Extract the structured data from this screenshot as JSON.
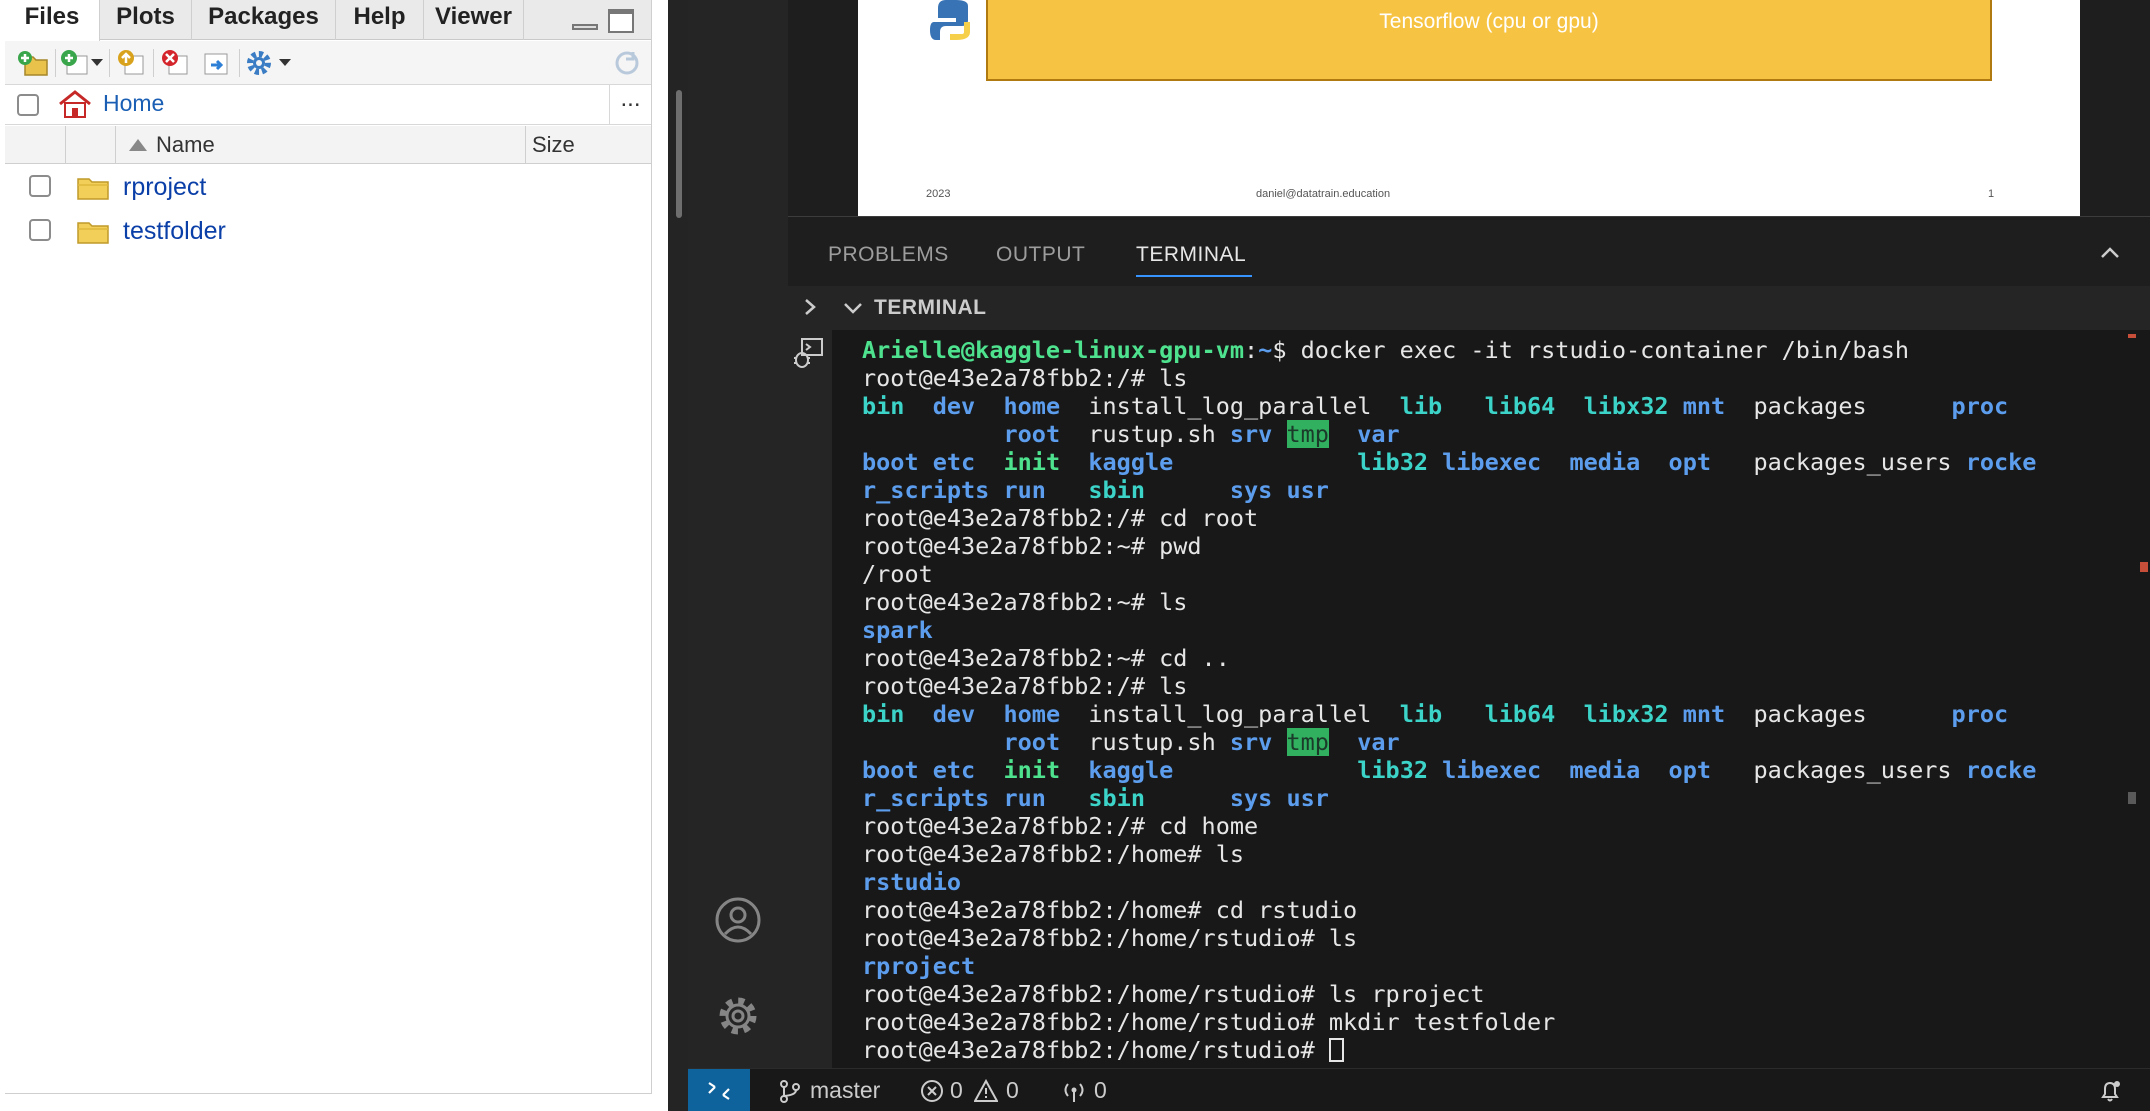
{
  "rstudio": {
    "tabs": [
      "Files",
      "Plots",
      "Packages",
      "Help",
      "Viewer"
    ],
    "active_tab": "Files",
    "path": "Home",
    "more": "...",
    "columns": {
      "name": "Name",
      "size": "Size"
    },
    "files": [
      {
        "name": "rproject",
        "type": "folder"
      },
      {
        "name": "testfolder",
        "type": "folder"
      }
    ],
    "toolbar_icons": [
      "new-folder-icon",
      "new-blank-file-icon",
      "upload-icon",
      "delete-icon",
      "rename-icon",
      "more-gear-icon",
      "refresh-icon"
    ]
  },
  "vscode": {
    "pdf": {
      "box_text": "Tensorflow (cpu or gpu)",
      "footer_left": "2023",
      "footer_center": "daniel@datatrain.education",
      "footer_right": "1"
    },
    "panel_tabs": [
      "PROBLEMS",
      "OUTPUT",
      "TERMINAL"
    ],
    "active_panel_tab": "TERMINAL",
    "terminal_title": "TERMINAL",
    "terminal_lines": [
      {
        "prompt_user": "Arielle@kaggle-linux-gpu-vm",
        "prompt_sep": ":",
        "prompt_path": "~",
        "prompt_end": "$ ",
        "cmd": "docker exec -it rstudio-container /bin/bash"
      },
      {
        "text": "root@e43e2a78fbb2:/# ls"
      },
      {
        "ls": 1
      },
      {
        "ls": 2
      },
      {
        "ls": 3
      },
      {
        "ls": 4
      },
      {
        "text": "root@e43e2a78fbb2:/# cd root"
      },
      {
        "text": "root@e43e2a78fbb2:~# pwd"
      },
      {
        "text": "/root"
      },
      {
        "text": "root@e43e2a78fbb2:~# ls"
      },
      {
        "dir": "spark"
      },
      {
        "text": "root@e43e2a78fbb2:~# cd .."
      },
      {
        "text": "root@e43e2a78fbb2:/# ls"
      },
      {
        "ls": 1
      },
      {
        "ls": 2
      },
      {
        "ls": 3
      },
      {
        "ls": 4
      },
      {
        "text": "root@e43e2a78fbb2:/# cd home"
      },
      {
        "text": "root@e43e2a78fbb2:/home# ls"
      },
      {
        "dir": "rstudio"
      },
      {
        "text": "root@e43e2a78fbb2:/home# cd rstudio"
      },
      {
        "text": "root@e43e2a78fbb2:/home/rstudio# ls"
      },
      {
        "dir": "rproject"
      },
      {
        "text": "root@e43e2a78fbb2:/home/rstudio# ls rproject"
      },
      {
        "text": "root@e43e2a78fbb2:/home/rstudio# mkdir testfolder"
      },
      {
        "text": "root@e43e2a78fbb2:/home/rstudio# ",
        "cursor": true
      }
    ],
    "ls_listing": {
      "row1": [
        {
          "t": "bin",
          "c": "link",
          "col": 0
        },
        {
          "t": "dev",
          "c": "dir",
          "col": 5
        },
        {
          "t": "home",
          "c": "dir",
          "col": 10
        },
        {
          "t": "install_log_parallel",
          "c": "plain",
          "col": 16
        },
        {
          "t": "lib",
          "c": "link",
          "col": 38
        },
        {
          "t": "lib64",
          "c": "link",
          "col": 44
        },
        {
          "t": "libx32",
          "c": "link",
          "col": 51
        },
        {
          "t": "mnt",
          "c": "dir",
          "col": 58
        },
        {
          "t": "packages",
          "c": "plain",
          "col": 63
        },
        {
          "t": "proc",
          "c": "dir",
          "col": 77
        }
      ],
      "row2": [
        {
          "t": "root",
          "c": "dir",
          "col": 10
        },
        {
          "t": "rustup.sh",
          "c": "plain",
          "col": 16
        },
        {
          "t": "srv",
          "c": "dir",
          "col": 26
        },
        {
          "t": "tmp",
          "c": "tmp",
          "col": 30
        },
        {
          "t": "var",
          "c": "dir",
          "col": 35
        }
      ],
      "row3": [
        {
          "t": "boot",
          "c": "dir",
          "col": 0
        },
        {
          "t": "etc",
          "c": "dir",
          "col": 5
        },
        {
          "t": "init",
          "c": "exec",
          "col": 10
        },
        {
          "t": "kaggle",
          "c": "dir",
          "col": 16
        },
        {
          "t": "lib32",
          "c": "link",
          "col": 35
        },
        {
          "t": "libexec",
          "c": "dir",
          "col": 41
        },
        {
          "t": "media",
          "c": "dir",
          "col": 50
        },
        {
          "t": "opt",
          "c": "dir",
          "col": 57
        },
        {
          "t": "packages_users",
          "c": "plain",
          "col": 63
        },
        {
          "t": "rocke",
          "c": "dir",
          "col": 78
        }
      ],
      "row4": [
        {
          "t": "r_scripts",
          "c": "dir",
          "col": 0
        },
        {
          "t": "run",
          "c": "dir",
          "col": 10
        },
        {
          "t": "sbin",
          "c": "link",
          "col": 16
        },
        {
          "t": "sys",
          "c": "dir",
          "col": 26
        },
        {
          "t": "usr",
          "c": "dir",
          "col": 30
        }
      ]
    },
    "status": {
      "branch": "master",
      "errors": "0",
      "warnings": "0",
      "ports": "0"
    }
  }
}
